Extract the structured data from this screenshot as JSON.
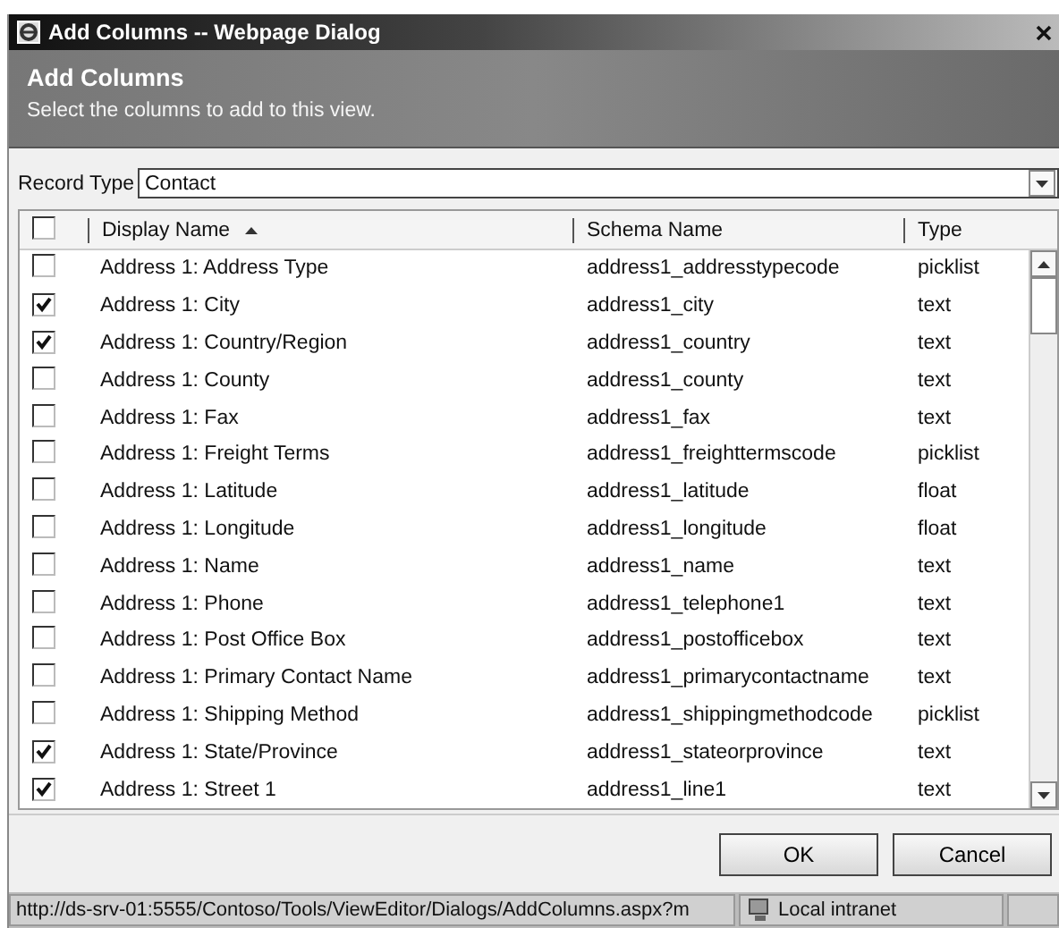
{
  "window": {
    "title": "Add Columns -- Webpage Dialog"
  },
  "header": {
    "title": "Add Columns",
    "subtitle": "Select the columns to add to this view."
  },
  "record_type": {
    "label": "Record Type",
    "value": "Contact"
  },
  "table": {
    "select_all": {
      "checked": false
    },
    "columns": [
      {
        "label": "Display Name",
        "sorted": true
      },
      {
        "label": "Schema Name",
        "sorted": false
      },
      {
        "label": "Type",
        "sorted": false
      }
    ],
    "rows": [
      {
        "checked": false,
        "display_name": "Address 1: Address Type",
        "schema_name": "address1_addresstypecode",
        "type": "picklist"
      },
      {
        "checked": true,
        "display_name": "Address 1: City",
        "schema_name": "address1_city",
        "type": "text"
      },
      {
        "checked": true,
        "display_name": "Address 1: Country/Region",
        "schema_name": "address1_country",
        "type": "text"
      },
      {
        "checked": false,
        "display_name": "Address 1: County",
        "schema_name": "address1_county",
        "type": "text"
      },
      {
        "checked": false,
        "display_name": "Address 1: Fax",
        "schema_name": "address1_fax",
        "type": "text"
      },
      {
        "checked": false,
        "display_name": "Address 1: Freight Terms",
        "schema_name": "address1_freighttermscode",
        "type": "picklist"
      },
      {
        "checked": false,
        "display_name": "Address 1: Latitude",
        "schema_name": "address1_latitude",
        "type": "float"
      },
      {
        "checked": false,
        "display_name": "Address 1: Longitude",
        "schema_name": "address1_longitude",
        "type": "float"
      },
      {
        "checked": false,
        "display_name": "Address 1: Name",
        "schema_name": "address1_name",
        "type": "text"
      },
      {
        "checked": false,
        "display_name": "Address 1: Phone",
        "schema_name": "address1_telephone1",
        "type": "text"
      },
      {
        "checked": false,
        "display_name": "Address 1: Post Office Box",
        "schema_name": "address1_postofficebox",
        "type": "text"
      },
      {
        "checked": false,
        "display_name": "Address 1: Primary Contact Name",
        "schema_name": "address1_primarycontactname",
        "type": "text"
      },
      {
        "checked": false,
        "display_name": "Address 1: Shipping Method",
        "schema_name": "address1_shippingmethodcode",
        "type": "picklist"
      },
      {
        "checked": true,
        "display_name": "Address 1: State/Province",
        "schema_name": "address1_stateorprovince",
        "type": "text"
      },
      {
        "checked": true,
        "display_name": "Address 1: Street 1",
        "schema_name": "address1_line1",
        "type": "text"
      }
    ]
  },
  "buttons": [
    {
      "label": "OK"
    },
    {
      "label": "Cancel"
    }
  ],
  "status_bar": {
    "url": "http://ds-srv-01:5555/Contoso/Tools/ViewEditor/Dialogs/AddColumns.aspx?m",
    "zone": "Local intranet"
  }
}
